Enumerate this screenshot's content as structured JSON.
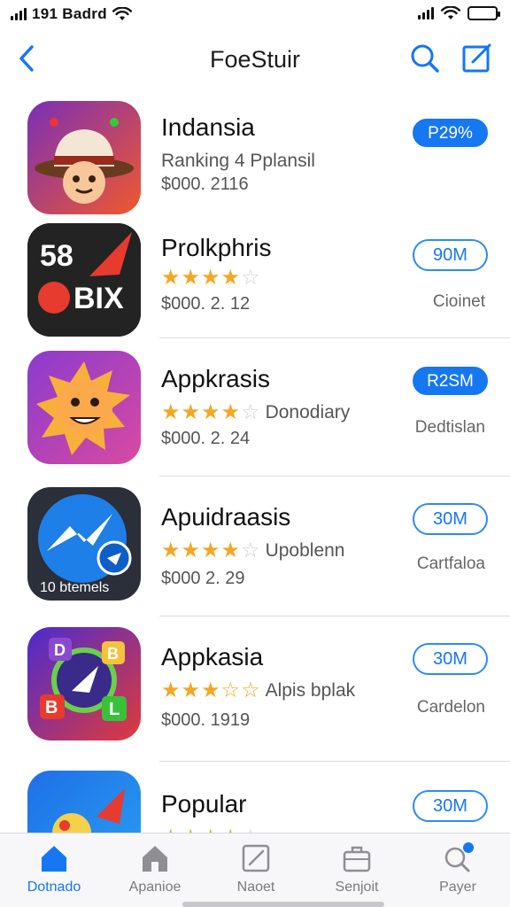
{
  "status": {
    "left_text": "191 Badrd"
  },
  "nav": {
    "title": "FoeStuir"
  },
  "apps": [
    {
      "name": "Indansia",
      "subtitle": "Ranking 4 Pplansil",
      "price": "$000. 2116",
      "button": "P29%",
      "button_style": "filled",
      "meta": "",
      "rating": null
    },
    {
      "name": "Prolkphris",
      "subtitle": "",
      "price": "$000. 2. 12",
      "button": "90M",
      "button_style": "outline",
      "meta": "Cioinet",
      "rating": 4
    },
    {
      "name": "Appkrasis",
      "subtitle": "Donodiary",
      "price": "$000. 2. 24",
      "button": "R2SM",
      "button_style": "filled",
      "meta": "Dedtislan",
      "rating": 4
    },
    {
      "name": "Apuidraasis",
      "subtitle": "Upoblenn",
      "price": "$000 2. 29",
      "button": "30M",
      "button_style": "outline",
      "meta": "Cartfaloa",
      "rating": 4
    },
    {
      "name": "Appkasia",
      "subtitle": "Alpis bplak",
      "price": "$000. 1919",
      "button": "30M",
      "button_style": "outline",
      "meta": "Cardelon",
      "rating": 3
    },
    {
      "name": "Popular",
      "subtitle": "",
      "price": "",
      "button": "30M",
      "button_style": "outline",
      "meta": "",
      "rating": 4
    }
  ],
  "icons": {
    "app2_text_top": "58",
    "app2_text_bottom": "BIX",
    "app4_text": "10 btemels",
    "app5_letters": [
      "D",
      "B",
      "B",
      "L"
    ]
  },
  "tabs": [
    {
      "label": "Dotnado",
      "icon": "home-icon",
      "active": true
    },
    {
      "label": "Apanioe",
      "icon": "store-icon",
      "active": false
    },
    {
      "label": "Naoet",
      "icon": "edit-icon",
      "active": false
    },
    {
      "label": "Senjoit",
      "icon": "briefcase-icon",
      "active": false
    },
    {
      "label": "Payer",
      "icon": "search-badge-icon",
      "active": false
    }
  ],
  "colors": {
    "accent": "#1677f2",
    "star": "#f5a623"
  }
}
